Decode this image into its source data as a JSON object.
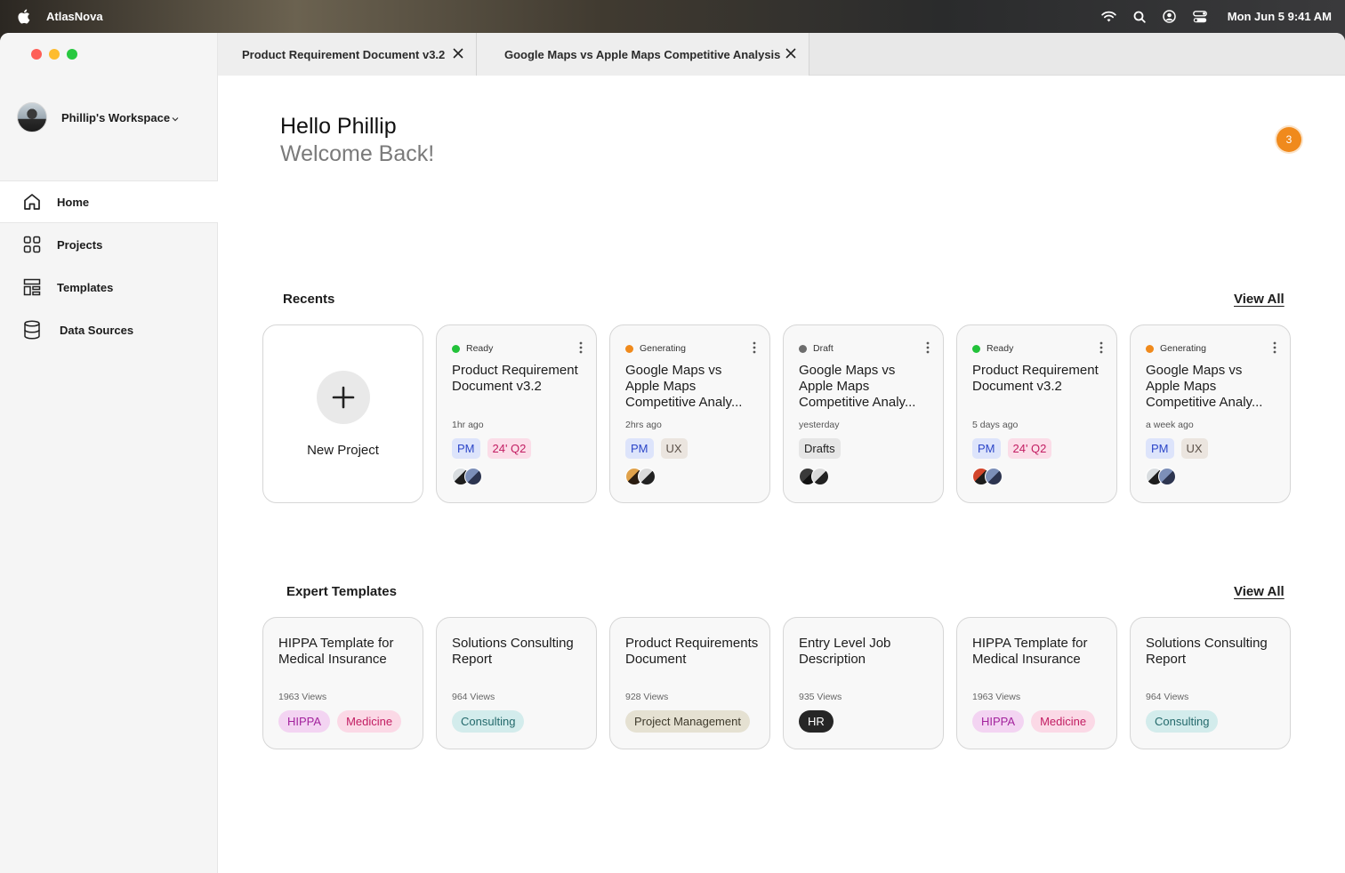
{
  "menubar": {
    "app_name": "AtlasNova",
    "clock": "Mon Jun 5  9:41 AM",
    "icons": [
      "wifi-icon",
      "search-icon",
      "user-circle-icon",
      "control-center-icon"
    ]
  },
  "window": {
    "tabs": [
      {
        "label": "Product Requirement Document v3.2"
      },
      {
        "label": "Google Maps vs Apple Maps Competitive Analysis"
      }
    ]
  },
  "sidebar": {
    "workspace_name": "Phillip's Workspace",
    "items": [
      {
        "label": "Home",
        "icon": "home-icon",
        "active": true
      },
      {
        "label": "Projects",
        "icon": "grid-icon"
      },
      {
        "label": "Templates",
        "icon": "templates-icon"
      },
      {
        "label": "Data Sources",
        "icon": "database-icon"
      }
    ]
  },
  "main": {
    "greeting": "Hello Phillip",
    "welcome": "Welcome Back!",
    "notification_count": "3",
    "recents_title": "Recents",
    "recents_view_all": "View All",
    "new_project_label": "New Project",
    "recents": [
      {
        "status": "Ready",
        "status_color": "#22c23a",
        "title": "Product Requirement Document v3.2",
        "time": "1hr ago",
        "tags": [
          {
            "label": "PM",
            "kind": "pm"
          },
          {
            "label": "24' Q2",
            "kind": "q2"
          }
        ]
      },
      {
        "status": "Generating",
        "status_color": "#f08a1c",
        "title": "Google Maps vs Apple Maps Competitive Analy...",
        "time": "2hrs ago",
        "tags": [
          {
            "label": "PM",
            "kind": "pm"
          },
          {
            "label": "UX",
            "kind": "ux"
          }
        ]
      },
      {
        "status": "Draft",
        "status_color": "#6d6d6d",
        "title": "Google Maps vs Apple Maps Competitive Analy...",
        "time": "yesterday",
        "tags": [
          {
            "label": "Drafts",
            "kind": "draft"
          }
        ]
      },
      {
        "status": "Ready",
        "status_color": "#22c23a",
        "title": "Product Requirement Document v3.2",
        "time": "5 days ago",
        "tags": [
          {
            "label": "PM",
            "kind": "pm"
          },
          {
            "label": "24' Q2",
            "kind": "q2"
          }
        ]
      },
      {
        "status": "Generating",
        "status_color": "#f08a1c",
        "title": "Google Maps vs Apple Maps Competitive Analy...",
        "time": "a week ago",
        "tags": [
          {
            "label": "PM",
            "kind": "pm"
          },
          {
            "label": "UX",
            "kind": "ux"
          }
        ]
      }
    ],
    "templates_title": "Expert Templates",
    "templates_view_all": "View All",
    "templates": [
      {
        "title": "HIPPA Template for Medical Insurance",
        "views": "1963 Views",
        "tags": [
          {
            "label": "HIPPA",
            "bg": "#f3d4f2",
            "fg": "#a3239d"
          },
          {
            "label": "Medicine",
            "bg": "#fbd9e6",
            "fg": "#c21d62"
          }
        ]
      },
      {
        "title": "Solutions Consulting Report",
        "views": "964 Views",
        "tags": [
          {
            "label": "Consulting",
            "bg": "#d3ecec",
            "fg": "#23696b"
          }
        ]
      },
      {
        "title": "Product Requirements Document",
        "views": "928 Views",
        "tags": [
          {
            "label": "Project Management",
            "bg": "#e5e1d2",
            "fg": "#3e3a2c"
          }
        ]
      },
      {
        "title": "Entry Level Job Description",
        "views": "935 Views",
        "tags": [
          {
            "label": "HR",
            "bg": "#262626",
            "fg": "#ffffff"
          }
        ]
      },
      {
        "title": "HIPPA Template for Medical Insurance",
        "views": "1963 Views",
        "tags": [
          {
            "label": "HIPPA",
            "bg": "#f3d4f2",
            "fg": "#a3239d"
          },
          {
            "label": "Medicine",
            "bg": "#fbd9e6",
            "fg": "#c21d62"
          }
        ]
      },
      {
        "title": "Solutions Consulting Report",
        "views": "964 Views",
        "tags": [
          {
            "label": "Consulting",
            "bg": "#d3ecec",
            "fg": "#23696b"
          }
        ]
      }
    ]
  }
}
